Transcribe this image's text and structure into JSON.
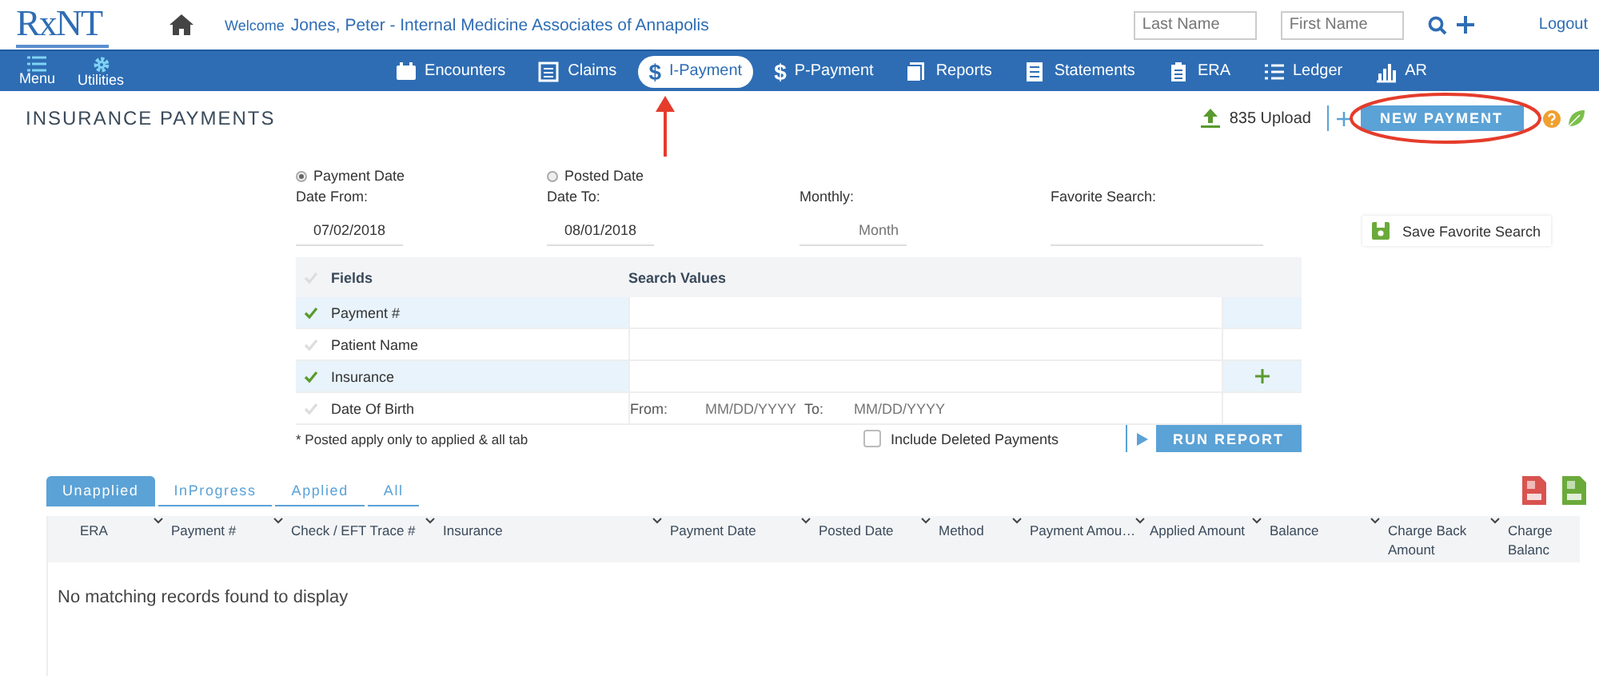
{
  "header": {
    "logo": "RxNT",
    "welcome_label": "Welcome",
    "user": "Jones, Peter - Internal Medicine Associates of Annapolis",
    "search_fields": [
      {
        "placeholder": "Last Name"
      },
      {
        "placeholder": "First Name"
      }
    ],
    "logout": "Logout"
  },
  "nav": {
    "left": [
      {
        "label": "Menu"
      },
      {
        "label": "Utilities"
      }
    ],
    "tabs": [
      {
        "label": "Encounters",
        "selected": false
      },
      {
        "label": "Claims",
        "selected": false
      },
      {
        "label": "I-Payment",
        "symbol": "$",
        "selected": true
      },
      {
        "label": "P-Payment",
        "symbol": "$",
        "selected": false
      },
      {
        "label": "Reports",
        "selected": false
      },
      {
        "label": "Statements",
        "selected": false
      },
      {
        "label": "ERA",
        "selected": false
      },
      {
        "label": "Ledger",
        "selected": false
      },
      {
        "label": "AR",
        "selected": false
      }
    ]
  },
  "page": {
    "title": "INSURANCE PAYMENTS",
    "upload_button": "835 Upload",
    "new_payment_button": "NEW PAYMENT"
  },
  "filters": {
    "date_type": [
      {
        "label": "Payment Date",
        "selected": true
      },
      {
        "label": "Posted Date",
        "selected": false
      }
    ],
    "date_from": {
      "label": "Date From:",
      "value": "07/02/2018"
    },
    "date_to": {
      "label": "Date To:",
      "value": "08/01/2018"
    },
    "monthly": {
      "label": "Monthly:",
      "placeholder": "Month"
    },
    "favorite_search": {
      "label": "Favorite Search:"
    },
    "save_favorite_button": "Save Favorite Search"
  },
  "fields_table": {
    "columns": [
      "Fields",
      "Search Values"
    ],
    "rows": [
      {
        "kind": "text",
        "field": "Payment #",
        "checked": true,
        "add_button": false
      },
      {
        "kind": "text",
        "field": "Patient Name",
        "checked": false,
        "add_button": false
      },
      {
        "kind": "text",
        "field": "Insurance",
        "checked": true,
        "add_button": true
      },
      {
        "kind": "date_range",
        "field": "Date Of Birth",
        "checked": false,
        "add_button": false,
        "from_label": "From:",
        "from_placeholder": "MM/DD/YYYY",
        "to_label": "To:",
        "to_placeholder": "MM/DD/YYYY"
      }
    ]
  },
  "note": "* Posted apply only to applied & all tab",
  "include_deleted": {
    "label": "Include Deleted Payments",
    "checked": false
  },
  "run_report_button": "RUN REPORT",
  "results": {
    "tabs": [
      {
        "label": "Unapplied",
        "selected": true
      },
      {
        "label": "InProgress",
        "selected": false
      },
      {
        "label": "Applied",
        "selected": false
      },
      {
        "label": "All",
        "selected": false
      }
    ],
    "columns": [
      "ERA",
      "Payment #",
      "Check / EFT Trace #",
      "Insurance",
      "Payment Date",
      "Posted Date",
      "Method",
      "Payment Amou…",
      "Applied Amount",
      "Balance",
      "Charge Back Amount",
      "Charge Balanc"
    ],
    "empty_message": "No matching records found to display"
  }
}
